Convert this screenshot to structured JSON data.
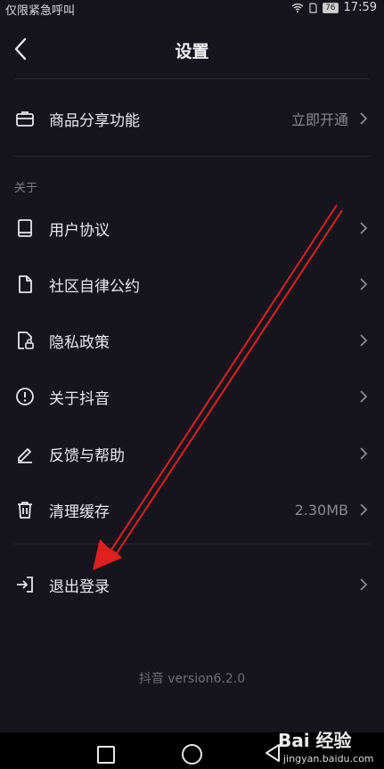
{
  "status": {
    "carrier": "仅限紧急呼叫",
    "battery": "76",
    "time": "17:59"
  },
  "header": {
    "title": "设置"
  },
  "items": [
    {
      "label": "商品分享功能",
      "value": "立即开通",
      "icon": "briefcase-icon"
    },
    {
      "label": "用户协议",
      "value": "",
      "icon": "book-icon"
    },
    {
      "label": "社区自律公约",
      "value": "",
      "icon": "document-icon"
    },
    {
      "label": "隐私政策",
      "value": "",
      "icon": "lock-document-icon"
    },
    {
      "label": "关于抖音",
      "value": "",
      "icon": "info-icon"
    },
    {
      "label": "反馈与帮助",
      "value": "",
      "icon": "pen-icon"
    },
    {
      "label": "清理缓存",
      "value": "2.30MB",
      "icon": "trash-icon"
    },
    {
      "label": "退出登录",
      "value": "",
      "icon": "logout-icon"
    }
  ],
  "section_about": "关于",
  "version": "抖音 version6.2.0",
  "watermark": {
    "brand": "Bai 经验",
    "url": "jingyan.baidu.com"
  },
  "colors": {
    "background": "#16151e",
    "annotation_arrow": "#e0201e"
  }
}
